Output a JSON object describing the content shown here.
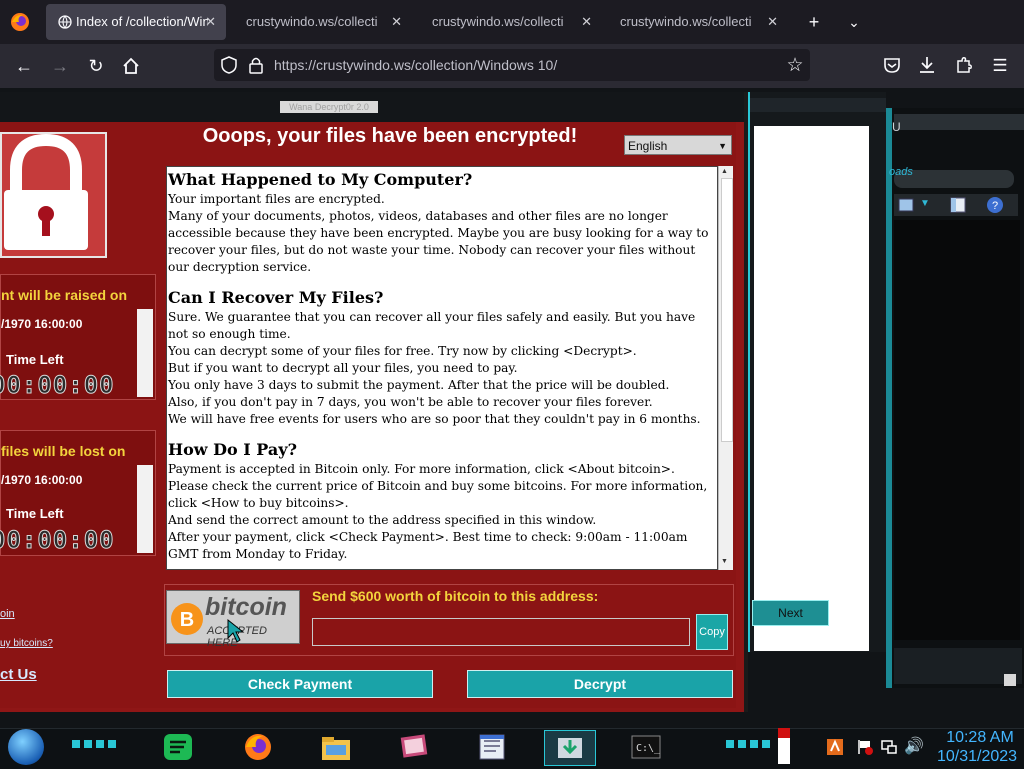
{
  "browser": {
    "tabs": [
      {
        "title": "Index of /collection/Win",
        "active": true
      },
      {
        "title": "crustywindo.ws/collection/\\",
        "active": false
      },
      {
        "title": "crustywindo.ws/collection/\\",
        "active": false
      },
      {
        "title": "crustywindo.ws/collection/\\",
        "active": false
      }
    ],
    "url": "https://crustywindo.ws/collection/Windows 10/"
  },
  "ransom_window": {
    "caption": "Wana Decrypt0r 2.0",
    "title": "Ooops, your files have been encrypted!",
    "language": "English",
    "raise_panel": {
      "label": "nt will be raised on",
      "date": "/1970 16:00:00",
      "time_left_label": "Time Left",
      "timer": "00:00:00"
    },
    "lost_panel": {
      "label": "files will be lost on",
      "date": "/1970 16:00:00",
      "time_left_label": "Time Left",
      "timer": "00:00:00"
    },
    "links": {
      "about_bitcoin": "oin",
      "how_to_buy": "uy bitcoins?",
      "contact": "ct Us"
    },
    "sections": [
      {
        "heading": "What Happened to My Computer?",
        "paragraphs": [
          "Your important files are encrypted.",
          "Many of your documents, photos, videos, databases and other files are no longer accessible because they have been encrypted. Maybe you are busy looking for a way to recover your files, but do not waste your time. Nobody can recover your files without our decryption service."
        ]
      },
      {
        "heading": "Can I Recover My Files?",
        "paragraphs": [
          "Sure. We guarantee that you can recover all your files safely and easily. But you have not so enough time.",
          "You can decrypt some of your files for free. Try now by clicking <Decrypt>.",
          "But if you want to decrypt all your files, you need to pay.",
          "You only have 3 days to submit the payment. After that the price will be doubled.",
          "Also, if you don't pay in 7 days, you won't be able to recover your files forever.",
          "We will have free events for users who are so poor that they couldn't pay in 6 months."
        ]
      },
      {
        "heading": "How Do I Pay?",
        "paragraphs": [
          "Payment is accepted in Bitcoin only. For more information, click <About bitcoin>.",
          "Please check the current price of Bitcoin and buy some bitcoins. For more information, click <How to buy bitcoins>.",
          "And send the correct amount to the address specified in this window.",
          "After your payment, click <Check Payment>. Best time to check: 9:00am - 11:00am GMT from Monday to Friday."
        ]
      }
    ],
    "bitcoin_logo_text": "bitcoin",
    "bitcoin_logo_sub": "ACCEPTED HERE",
    "send_label": "Send $600 worth of bitcoin to this address:",
    "address": "",
    "copy_label": "Copy",
    "check_payment_label": "Check Payment",
    "decrypt_label": "Decrypt"
  },
  "background_window": {
    "next_label": "Next",
    "side_label": "oads",
    "u_label": "U"
  },
  "taskbar": {
    "time": "10:28 AM",
    "date": "10/31/2023"
  },
  "colors": {
    "ransom_red": "#8b1414",
    "accent_teal": "#1aa3a8",
    "warning_yellow": "#f3d43d",
    "clock_blue": "#43b6ff"
  }
}
